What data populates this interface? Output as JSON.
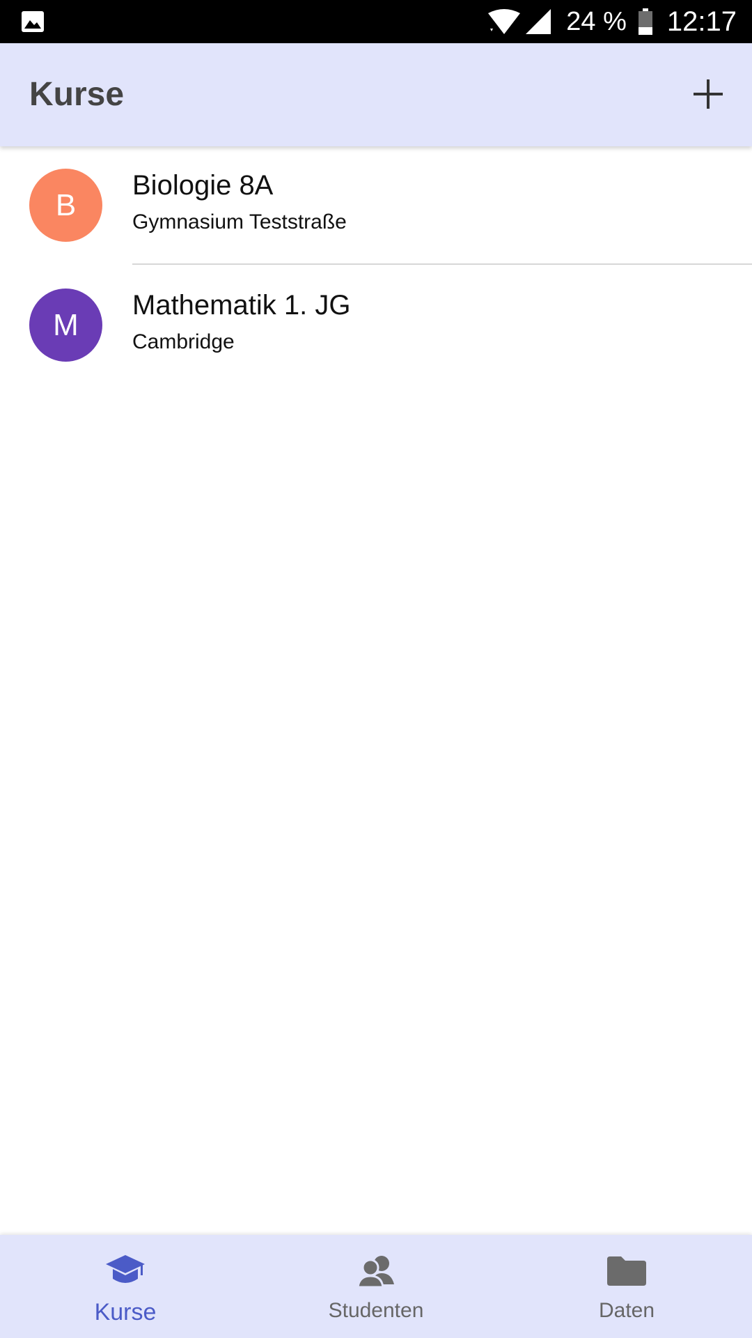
{
  "status_bar": {
    "battery_text": "24 %",
    "clock": "12:17",
    "icons": [
      "gallery-icon",
      "wifi-icon",
      "signal-icon",
      "battery-icon"
    ]
  },
  "app_bar": {
    "title": "Kurse",
    "action_icon": "plus-icon"
  },
  "courses": [
    {
      "initial": "B",
      "title": "Biologie 8A",
      "subtitle": "Gymnasium Teststraße",
      "color": "#fa8661"
    },
    {
      "initial": "M",
      "title": "Mathematik 1. JG",
      "subtitle": "Cambridge",
      "color": "#6a3cb5"
    }
  ],
  "bottom_nav": {
    "items": [
      {
        "label": "Kurse",
        "icon": "graduation-cap-icon",
        "active": true
      },
      {
        "label": "Studenten",
        "icon": "people-icon",
        "active": false
      },
      {
        "label": "Daten",
        "icon": "folder-icon",
        "active": false
      }
    ]
  },
  "colors": {
    "app_bar_background": "#e1e4fb",
    "accent": "#4b5bc7",
    "inactive": "#666666"
  }
}
